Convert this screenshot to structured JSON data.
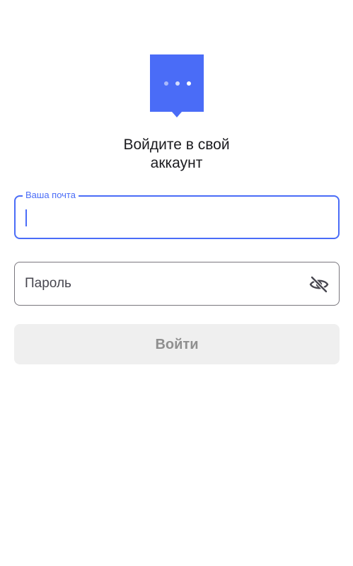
{
  "logo": {
    "icon": "chat-bubble-dots-icon",
    "color": "#4a6cf7"
  },
  "title": {
    "line1": "Войдите в свой",
    "line2": "аккаунт"
  },
  "email_field": {
    "label": "Ваша почта",
    "value": "",
    "focused": true,
    "accent_color": "#4a6cf7"
  },
  "password_field": {
    "placeholder": "Пароль",
    "value": "",
    "visibility_icon": "eye-off-icon"
  },
  "login_button": {
    "label": "Войти",
    "enabled": false,
    "background": "#efefef"
  }
}
